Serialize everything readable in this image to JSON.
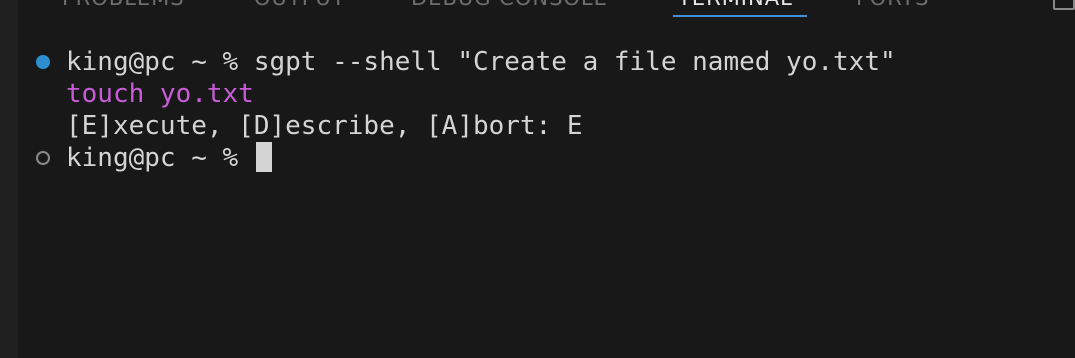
{
  "tabs": {
    "problems": "PROBLEMS",
    "output": "OUTPUT",
    "debug_console": "DEBUG CONSOLE",
    "terminal": "TERMINAL",
    "ports": "PORTS",
    "active": "TERMINAL"
  },
  "terminal": {
    "line1": {
      "prompt": "king@pc ~ % ",
      "command": "sgpt --shell \"Create a file named yo.txt\"",
      "status": "success"
    },
    "line2": {
      "text": "touch yo.txt"
    },
    "line3": {
      "text": "[E]xecute, [D]escribe, [A]bort: E"
    },
    "line4": {
      "prompt": "king@pc ~ % ",
      "status": "pending"
    }
  },
  "colors": {
    "background": "#181818",
    "text": "#d4d4d4",
    "suggested_command": "#c85bd6",
    "success_decoration": "#2e8fd0",
    "active_tab_underline": "#3f8fd6"
  },
  "icons": {
    "tab_tool": "maximize-panel-icon",
    "line1_decoration": "command-success-circle-icon",
    "line4_decoration": "command-pending-circle-icon"
  }
}
